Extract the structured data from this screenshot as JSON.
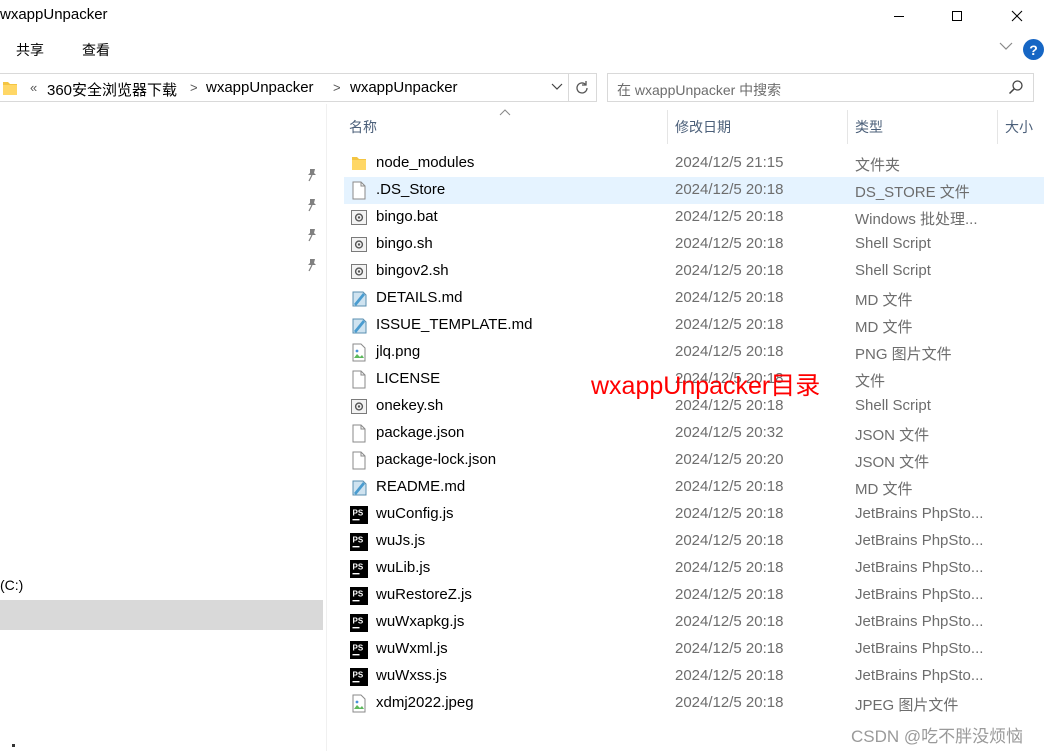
{
  "window": {
    "title": "wxappUnpacker",
    "minimize_icon": "minimize-icon",
    "maximize_icon": "maximize-icon",
    "close_icon": "close-icon"
  },
  "ribbon": {
    "tabs": [
      {
        "label": "共享"
      },
      {
        "label": "查看"
      }
    ],
    "help_label": "?"
  },
  "address": {
    "overflow": "«",
    "segments": [
      "360安全浏览器下载",
      "wxappUnpacker",
      "wxappUnpacker"
    ],
    "separator": ">"
  },
  "search": {
    "placeholder": "在 wxappUnpacker 中搜索"
  },
  "nav": {
    "drive_label": "(C:)"
  },
  "columns": {
    "name": "名称",
    "date": "修改日期",
    "type": "类型",
    "size": "大小"
  },
  "files": [
    {
      "name": "node_modules",
      "date": "2024/12/5 21:15",
      "type": "文件夹",
      "icon": "folder-icon"
    },
    {
      "name": ".DS_Store",
      "date": "2024/12/5 20:18",
      "type": "DS_STORE 文件",
      "icon": "file-icon",
      "selected": true
    },
    {
      "name": "bingo.bat",
      "date": "2024/12/5 20:18",
      "type": "Windows 批处理...",
      "icon": "script-icon"
    },
    {
      "name": "bingo.sh",
      "date": "2024/12/5 20:18",
      "type": "Shell Script",
      "icon": "script-icon"
    },
    {
      "name": "bingov2.sh",
      "date": "2024/12/5 20:18",
      "type": "Shell Script",
      "icon": "script-icon"
    },
    {
      "name": "DETAILS.md",
      "date": "2024/12/5 20:18",
      "type": "MD 文件",
      "icon": "markdown-icon"
    },
    {
      "name": "ISSUE_TEMPLATE.md",
      "date": "2024/12/5 20:18",
      "type": "MD 文件",
      "icon": "markdown-icon"
    },
    {
      "name": "jlq.png",
      "date": "2024/12/5 20:18",
      "type": "PNG 图片文件",
      "icon": "image-icon"
    },
    {
      "name": "LICENSE",
      "date": "2024/12/5 20:18",
      "type": "文件",
      "icon": "file-icon"
    },
    {
      "name": "onekey.sh",
      "date": "2024/12/5 20:18",
      "type": "Shell Script",
      "icon": "script-icon"
    },
    {
      "name": "package.json",
      "date": "2024/12/5 20:32",
      "type": "JSON 文件",
      "icon": "file-icon"
    },
    {
      "name": "package-lock.json",
      "date": "2024/12/5 20:20",
      "type": "JSON 文件",
      "icon": "file-icon"
    },
    {
      "name": "README.md",
      "date": "2024/12/5 20:18",
      "type": "MD 文件",
      "icon": "markdown-icon"
    },
    {
      "name": "wuConfig.js",
      "date": "2024/12/5 20:18",
      "type": "JetBrains PhpSto...",
      "icon": "phpstorm-icon"
    },
    {
      "name": "wuJs.js",
      "date": "2024/12/5 20:18",
      "type": "JetBrains PhpSto...",
      "icon": "phpstorm-icon"
    },
    {
      "name": "wuLib.js",
      "date": "2024/12/5 20:18",
      "type": "JetBrains PhpSto...",
      "icon": "phpstorm-icon"
    },
    {
      "name": "wuRestoreZ.js",
      "date": "2024/12/5 20:18",
      "type": "JetBrains PhpSto...",
      "icon": "phpstorm-icon"
    },
    {
      "name": "wuWxapkg.js",
      "date": "2024/12/5 20:18",
      "type": "JetBrains PhpSto...",
      "icon": "phpstorm-icon"
    },
    {
      "name": "wuWxml.js",
      "date": "2024/12/5 20:18",
      "type": "JetBrains PhpSto...",
      "icon": "phpstorm-icon"
    },
    {
      "name": "wuWxss.js",
      "date": "2024/12/5 20:18",
      "type": "JetBrains PhpSto...",
      "icon": "phpstorm-icon"
    },
    {
      "name": "xdmj2022.jpeg",
      "date": "2024/12/5 20:18",
      "type": "JPEG 图片文件",
      "icon": "image-icon"
    }
  ],
  "annotation": {
    "text": "wxappUnpacker目录",
    "color": "#ff0000"
  },
  "watermark": {
    "text": "CSDN @吃不胖没烦恼"
  },
  "colors": {
    "selected_row": "#e5f3ff",
    "nav_selected": "#d9d9d9",
    "help_blue": "#1666c4",
    "header_text": "#4c607a"
  }
}
